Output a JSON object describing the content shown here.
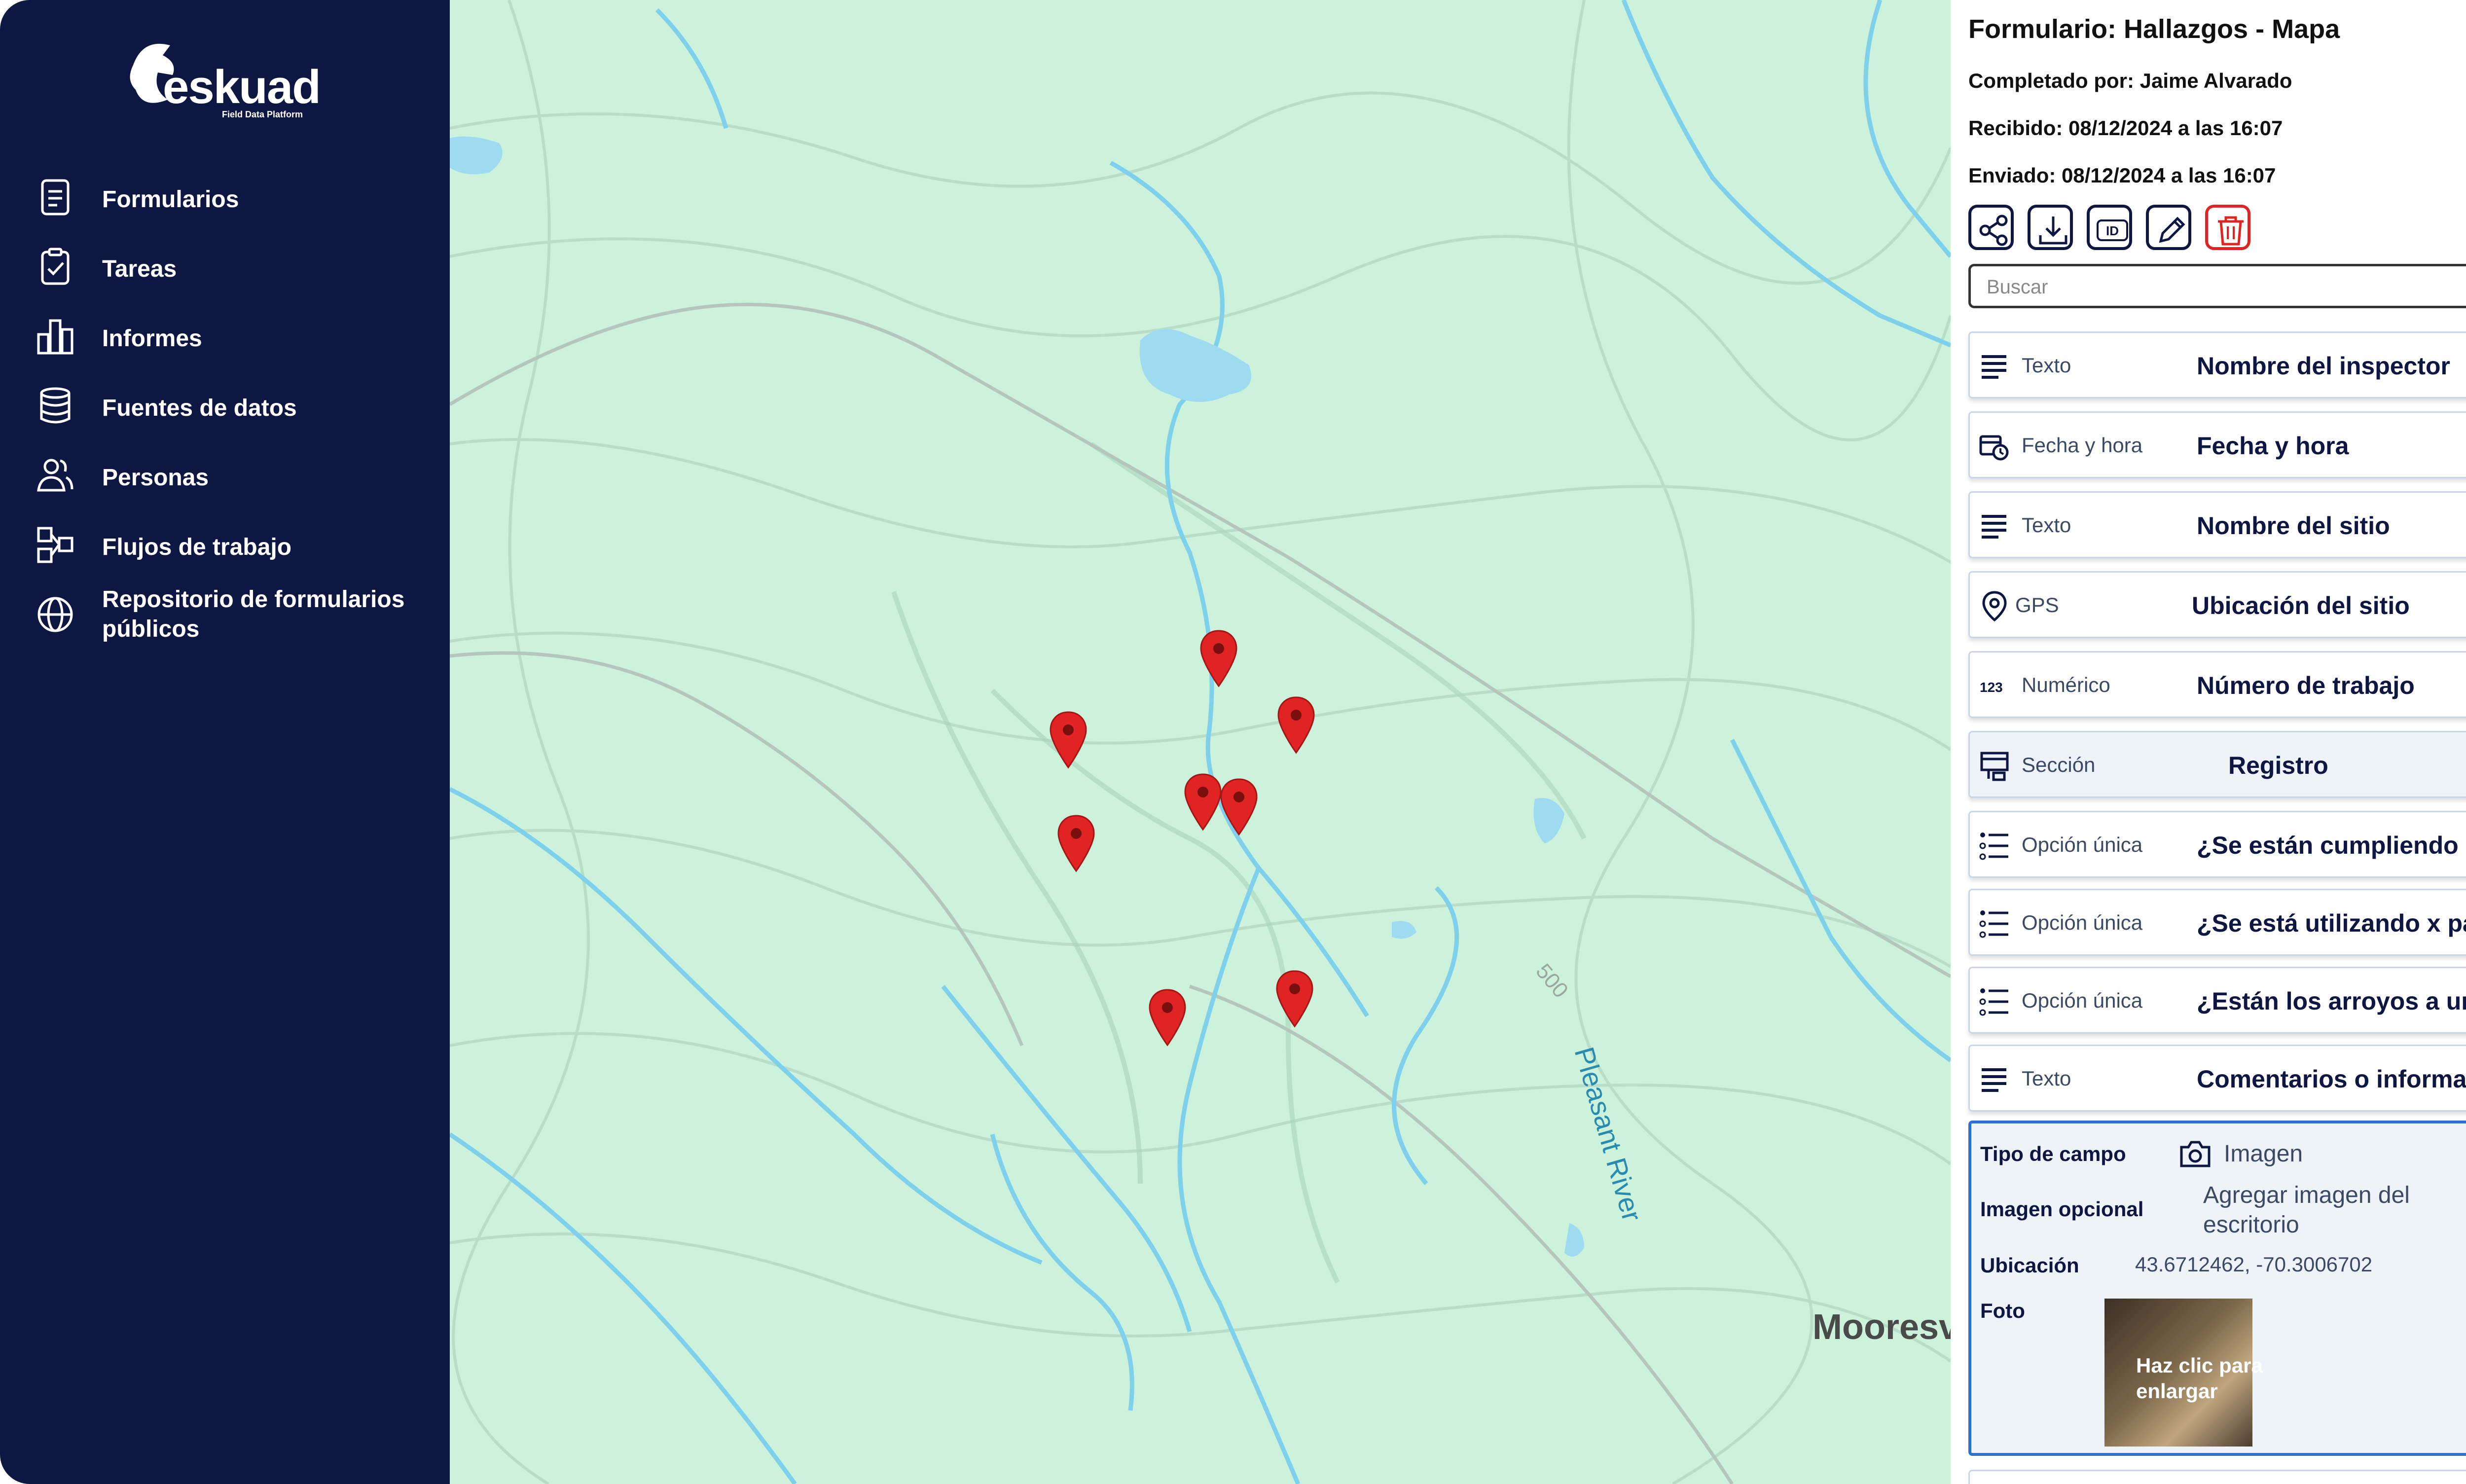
{
  "brand": {
    "name": "eskuad",
    "tagline": "Field Data Platform"
  },
  "sidebar": {
    "items": [
      {
        "label": "Formularios",
        "icon": "form-icon"
      },
      {
        "label": "Tareas",
        "icon": "clipboard-check-icon"
      },
      {
        "label": "Informes",
        "icon": "bar-chart-icon"
      },
      {
        "label": "Fuentes de datos",
        "icon": "database-icon"
      },
      {
        "label": "Personas",
        "icon": "users-icon"
      },
      {
        "label": "Flujos de trabajo",
        "icon": "workflow-icon"
      },
      {
        "label": "Repositorio de formularios públicos",
        "icon": "globe-icon"
      }
    ]
  },
  "map": {
    "river_label": "Pleasant River",
    "contour_label": "500",
    "place_label": "Mooresv",
    "pin_color": "#e02424",
    "pin_count": 8
  },
  "panel": {
    "title": "Formulario: Hallazgos - Mapa",
    "completed_by": "Completado por: Jaime Alvarado",
    "received": "Recibido: 08/12/2024 a las 16:07",
    "sent": "Enviado: 08/12/2024 a las 16:07",
    "toolbar": {
      "share": "share-icon",
      "download": "download-icon",
      "id_label": "ID",
      "edit": "pencil-icon",
      "delete": "trash-icon"
    },
    "search": {
      "placeholder": "Buscar"
    },
    "fields": [
      {
        "type": "Texto",
        "name": "Nombre del inspector",
        "icon": "text-lines-icon"
      },
      {
        "type": "Fecha y hora",
        "name": "Fecha y hora",
        "icon": "calendar-clock-icon"
      },
      {
        "type": "Texto",
        "name": "Nombre del sitio",
        "icon": "text-lines-icon"
      },
      {
        "type": "GPS",
        "name": "Ubicación del sitio",
        "icon": "location-pin-icon"
      },
      {
        "type": "Numérico",
        "name": "Número de trabajo",
        "icon": "numeric-icon",
        "icon_text": "123"
      },
      {
        "type": "Sección",
        "name": "Registro",
        "icon": "section-icon",
        "expanded": true
      },
      {
        "type": "Opción única",
        "name": "¿Se están cumpliendo las...",
        "icon": "single-choice-icon"
      },
      {
        "type": "Opción única",
        "name": "¿Se está utilizando x para...",
        "icon": "single-choice-icon"
      },
      {
        "type": "Opción única",
        "name": "¿Están los arroyos a una...",
        "icon": "single-choice-icon"
      },
      {
        "type": "Texto",
        "name": "Comentarios o informaci...",
        "icon": "text-lines-icon"
      }
    ],
    "detail": {
      "field_type_label": "Tipo de campo",
      "field_type_value": "Imagen",
      "optional_label": "Imagen opcional",
      "optional_value": "Agregar imagen del escritorio",
      "location_label": "Ubicación",
      "location_value": "43.6712462, -70.3006702",
      "photo_label": "Foto",
      "photo_caption": "Haz clic para enlargar"
    }
  },
  "colors": {
    "sidebar_bg": "#0d1742",
    "map_bg": "#cdf2dc",
    "accent": "#2f6fd1",
    "danger": "#e02424"
  }
}
